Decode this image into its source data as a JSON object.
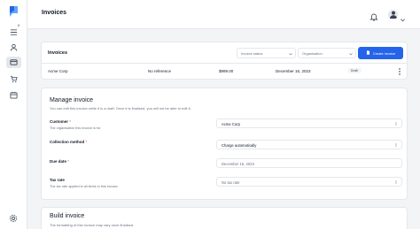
{
  "sidebar": {
    "badge": "0",
    "colors": {
      "logo": "#3b82f6",
      "active_bg": "#e5e7eb"
    },
    "icons": [
      "logo-icon",
      "list-icon",
      "user-icon",
      "invoice-icon",
      "cart-icon",
      "calendar-icon",
      "gear-icon"
    ]
  },
  "header": {
    "title": "Invoices",
    "icons": [
      "bell-icon",
      "user-avatar-icon",
      "chevron-down-icon"
    ]
  },
  "invoices_card": {
    "title": "Invoices",
    "status_placeholder": "Invoice status",
    "org_placeholder": "Organisation",
    "create_label": "Create invoice",
    "accent": "#2563eb",
    "row": {
      "customer": "Acme Corp",
      "reference": "No reference",
      "amount": "$999.00",
      "date": "December 16, 2023",
      "status": "Draft"
    }
  },
  "manage": {
    "title": "Manage invoice",
    "subtitle": "You can edit this invoice while it is a draft. Once it is finalised, you will not be able to edit it.",
    "customer": {
      "label": "Customer",
      "required": "*",
      "help": "The organisation this invoice is for.",
      "value": "Acme Corp"
    },
    "collection": {
      "label": "Collection method",
      "required": "*",
      "value": "Charge automatically"
    },
    "due_date": {
      "label": "Due date",
      "required": "*",
      "value": "December 16, 2023"
    },
    "tax_rate": {
      "label": "Tax rate",
      "help": "The tax rate applied to all items in this invoice.",
      "value": "No tax rate"
    }
  },
  "build": {
    "title": "Build invoice",
    "subtitle": "The formatting of this invoice may vary once finalised."
  }
}
